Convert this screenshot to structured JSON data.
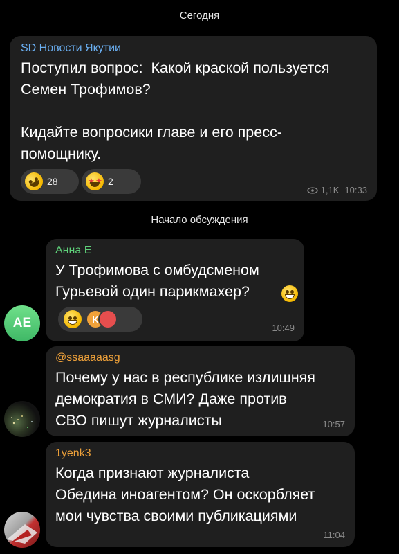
{
  "date_label": "Сегодня",
  "channel_post": {
    "channel_name": "SD Новости Якутии",
    "text": "Поступил вопрос:  Какой краской пользуется\nСемен Трофимов?\n\nКидайте вопросики главе и его пресс-\nпомощнику.",
    "reactions": [
      {
        "emoji": "rofl-emoji",
        "count": "28"
      },
      {
        "emoji": "star-struck-emoji",
        "count": "2"
      }
    ],
    "views": "1,1K",
    "time": "10:33"
  },
  "discussion_label": "Начало обсуждения",
  "comments": [
    {
      "author": "Анна Е",
      "author_color": "#5fd07a",
      "avatar_initials": "AE",
      "text": "У Трофимова с омбудсменом\nГурьевой один парикмахер?",
      "reaction_mini_avatar": "K",
      "time": "10:49"
    },
    {
      "author": "@ssaaaaasg",
      "author_color": "#f0a23a",
      "text": "Почему у нас в республике излишняя\nдемократия в СМИ? Даже против\nСВО пишут журналисты",
      "time": "10:57"
    },
    {
      "author": "1yenk3",
      "author_color": "#f0a23a",
      "text": "Когда признают журналиста\nОбедина иноагентом? Он оскорбляет\nмои чувства своими публикациями",
      "time": "11:04"
    }
  ],
  "colors": {
    "background": "#000000",
    "bubble": "#1f1f1f",
    "channel_name": "#6aaef0",
    "meta": "#8a8a8a"
  }
}
